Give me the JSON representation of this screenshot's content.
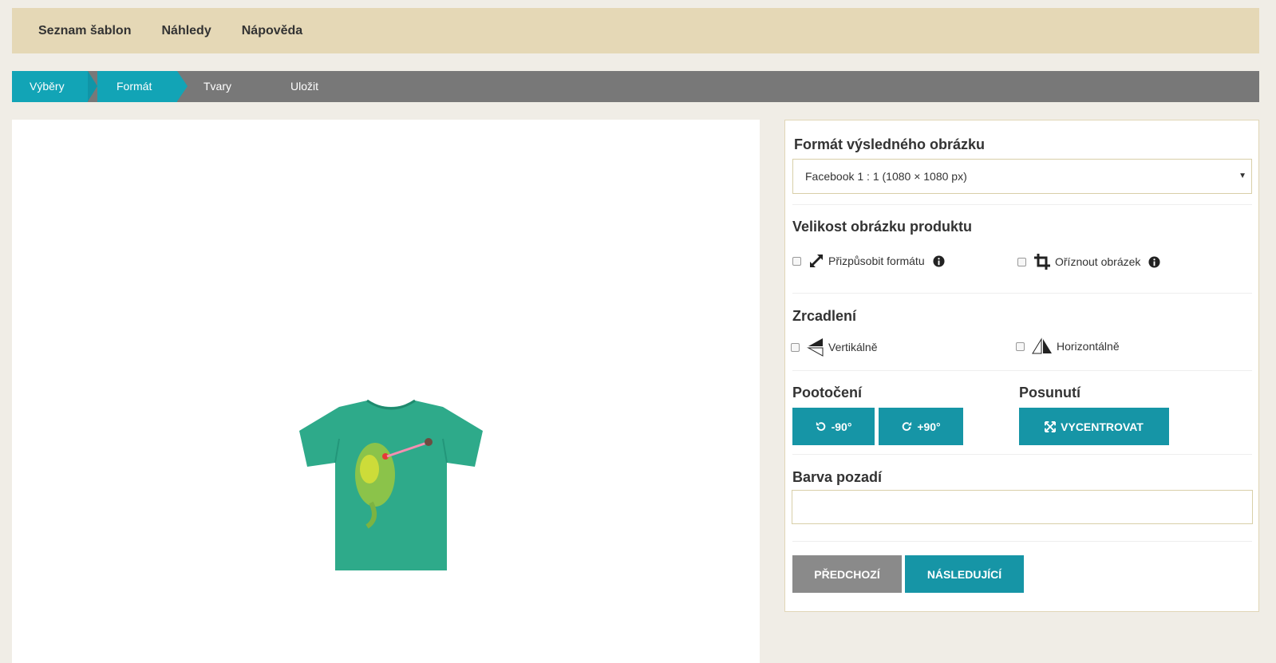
{
  "topnav": {
    "items": [
      "Seznam šablon",
      "Náhledy",
      "Nápověda"
    ]
  },
  "steps": {
    "items": [
      "Výběry",
      "Formát",
      "Tvary",
      "Uložit"
    ],
    "active_color": "#12a4b6",
    "inactive_color": "#787878"
  },
  "panel": {
    "format_title": "Formát výsledného obrázku",
    "format_value": "Facebook 1 : 1 (1080 × 1080 px)",
    "size_title": "Velikost obrázku produktu",
    "fit_label": "Přizpůsobit formátu",
    "crop_label": "Oříznout obrázek",
    "mirror_title": "Zrcadlení",
    "vertical_label": "Vertikálně",
    "horizontal_label": "Horizontálně",
    "rotation_title": "Pootočení",
    "rotate_left_label": "-90°",
    "rotate_right_label": "+90°",
    "shift_title": "Posunutí",
    "center_label": "VYCENTROVAT",
    "bg_title": "Barva pozadí",
    "prev_label": "PŘEDCHOZÍ",
    "next_label": "NÁSLEDUJÍCÍ"
  },
  "colors": {
    "accent": "#1695a6",
    "nav_bg": "#e5d8b6",
    "page_bg": "#f0ede6",
    "shirt": "#2eaa8a"
  },
  "icons": [
    "expand-icon",
    "info-icon",
    "crop-icon",
    "flip-vertical-icon",
    "flip-horizontal-icon",
    "rotate-left-icon",
    "rotate-right-icon",
    "center-icon"
  ]
}
